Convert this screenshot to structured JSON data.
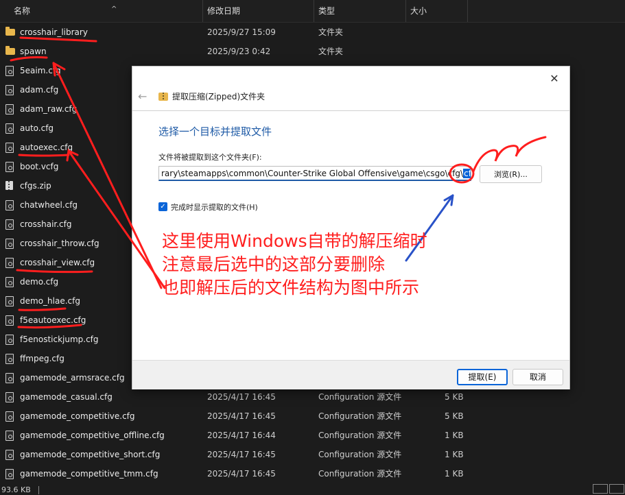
{
  "columns": {
    "name": "名称",
    "date": "修改日期",
    "type": "类型",
    "size": "大小"
  },
  "files": [
    {
      "name": "crosshair_library",
      "date": "2025/9/27 15:09",
      "type": "文件夹",
      "size": "",
      "icon": "folder-icon"
    },
    {
      "name": "spawn",
      "date": "2025/9/23 0:42",
      "type": "文件夹",
      "size": "",
      "icon": "folder-icon"
    },
    {
      "name": "5eaim.cfg",
      "date": "",
      "type": "",
      "size": "",
      "icon": "file-icon"
    },
    {
      "name": "adam.cfg",
      "date": "",
      "type": "",
      "size": "",
      "icon": "file-icon"
    },
    {
      "name": "adam_raw.cfg",
      "date": "",
      "type": "",
      "size": "",
      "icon": "file-icon"
    },
    {
      "name": "auto.cfg",
      "date": "",
      "type": "",
      "size": "",
      "icon": "file-icon"
    },
    {
      "name": "autoexec.cfg",
      "date": "",
      "type": "",
      "size": "",
      "icon": "file-icon"
    },
    {
      "name": "boot.vcfg",
      "date": "",
      "type": "",
      "size": "",
      "icon": "file-icon"
    },
    {
      "name": "cfgs.zip",
      "date": "",
      "type": "",
      "size": "",
      "icon": "zip-icon"
    },
    {
      "name": "chatwheel.cfg",
      "date": "",
      "type": "",
      "size": "",
      "icon": "file-icon"
    },
    {
      "name": "crosshair.cfg",
      "date": "",
      "type": "",
      "size": "",
      "icon": "file-icon"
    },
    {
      "name": "crosshair_throw.cfg",
      "date": "",
      "type": "",
      "size": "",
      "icon": "file-icon"
    },
    {
      "name": "crosshair_view.cfg",
      "date": "",
      "type": "",
      "size": "",
      "icon": "file-icon"
    },
    {
      "name": "demo.cfg",
      "date": "",
      "type": "",
      "size": "",
      "icon": "file-icon"
    },
    {
      "name": "demo_hlae.cfg",
      "date": "",
      "type": "",
      "size": "",
      "icon": "file-icon"
    },
    {
      "name": "f5eautoexec.cfg",
      "date": "",
      "type": "",
      "size": "",
      "icon": "file-icon"
    },
    {
      "name": "f5enostickjump.cfg",
      "date": "",
      "type": "",
      "size": "",
      "icon": "file-icon"
    },
    {
      "name": "ffmpeg.cfg",
      "date": "",
      "type": "",
      "size": "",
      "icon": "file-icon"
    },
    {
      "name": "gamemode_armsrace.cfg",
      "date": "",
      "type": "",
      "size": "",
      "icon": "file-icon"
    },
    {
      "name": "gamemode_casual.cfg",
      "date": "2025/4/17 16:45",
      "type": "Configuration 源文件",
      "size": "5 KB",
      "icon": "file-icon"
    },
    {
      "name": "gamemode_competitive.cfg",
      "date": "2025/4/17 16:45",
      "type": "Configuration 源文件",
      "size": "5 KB",
      "icon": "file-icon"
    },
    {
      "name": "gamemode_competitive_offline.cfg",
      "date": "2025/4/17 16:44",
      "type": "Configuration 源文件",
      "size": "1 KB",
      "icon": "file-icon"
    },
    {
      "name": "gamemode_competitive_short.cfg",
      "date": "2025/4/17 16:45",
      "type": "Configuration 源文件",
      "size": "1 KB",
      "icon": "file-icon"
    },
    {
      "name": "gamemode_competitive_tmm.cfg",
      "date": "2025/4/17 16:45",
      "type": "Configuration 源文件",
      "size": "1 KB",
      "icon": "file-icon"
    }
  ],
  "status": {
    "selected_size": "93.6 KB"
  },
  "dialog": {
    "title": "提取压缩(Zipped)文件夹",
    "close": "✕",
    "back": "←",
    "heading": "选择一个目标并提取文件",
    "dest_label": "文件将被提取到这个文件夹(F):",
    "path_main": "rary\\steamapps\\common\\Counter-Strike Global Offensive\\game\\csgo\\cfg\\",
    "path_selected": "cfgs",
    "browse": "浏览(R)...",
    "checkbox_checked": true,
    "checkbox_mark": "✓",
    "checkbox_label": "完成时显示提取的文件(H)",
    "extract": "提取(E)",
    "cancel": "取消"
  },
  "annotation": {
    "lines": [
      "这里使用Windows自带的解压缩时",
      "注意最后选中的这部分要删除",
      "也即解压后的文件结构为图中所示"
    ],
    "color": "#ff1e1e"
  },
  "colors": {
    "accent": "#0a64d8",
    "heading": "#1e5aa6",
    "folder": "#e8b64c"
  }
}
